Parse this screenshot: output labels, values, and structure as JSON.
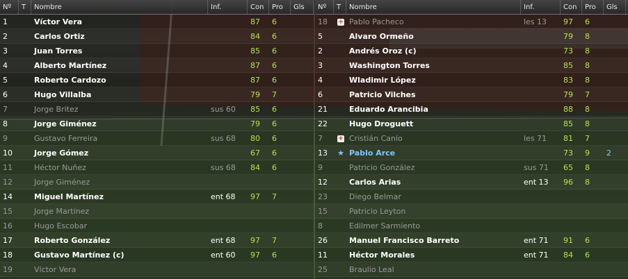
{
  "colors": {
    "con_pro": "#b8e24a",
    "goals": "#7fc6ff",
    "dimmed": "#9a9a9a",
    "highlight": "#7fc6ff",
    "injury": "#d21d1d"
  },
  "headers": {
    "num": "Nº",
    "t": "T",
    "name": "Nombre",
    "inf": "Inf.",
    "con": "Con",
    "pro": "Pro",
    "gls": "Gls"
  },
  "left_team": [
    {
      "num": "1",
      "name": "Víctor Vera",
      "inf": "",
      "con": "87",
      "pro": "6",
      "gls": "",
      "dim": false
    },
    {
      "num": "2",
      "name": "Carlos Ortiz",
      "inf": "",
      "con": "84",
      "pro": "6",
      "gls": "",
      "dim": false
    },
    {
      "num": "3",
      "name": "Juan Torres",
      "inf": "",
      "con": "85",
      "pro": "6",
      "gls": "",
      "dim": false
    },
    {
      "num": "4",
      "name": "Alberto Martínez",
      "inf": "",
      "con": "87",
      "pro": "6",
      "gls": "",
      "dim": false
    },
    {
      "num": "5",
      "name": "Roberto Cardozo",
      "inf": "",
      "con": "87",
      "pro": "6",
      "gls": "",
      "dim": false
    },
    {
      "num": "6",
      "name": "Hugo Villalba",
      "inf": "",
      "con": "79",
      "pro": "7",
      "gls": "",
      "dim": false
    },
    {
      "num": "7",
      "name": "Jorge Britez",
      "inf": "sus 60",
      "con": "85",
      "pro": "6",
      "gls": "",
      "dim": true
    },
    {
      "num": "8",
      "name": "Jorge Giménez",
      "inf": "",
      "con": "79",
      "pro": "6",
      "gls": "",
      "dim": false
    },
    {
      "num": "9",
      "name": "Gustavo Ferreira",
      "inf": "sus 68",
      "con": "80",
      "pro": "6",
      "gls": "",
      "dim": true
    },
    {
      "num": "10",
      "name": "Jorge Gómez",
      "inf": "",
      "con": "67",
      "pro": "6",
      "gls": "",
      "dim": false
    },
    {
      "num": "11",
      "name": "Héctor Nuñez",
      "inf": "sus 68",
      "con": "84",
      "pro": "6",
      "gls": "",
      "dim": true
    },
    {
      "num": "12",
      "name": "Jorge Giménez",
      "inf": "",
      "con": "",
      "pro": "",
      "gls": "",
      "dim": true
    },
    {
      "num": "14",
      "name": "Miguel Martínez",
      "inf": "ent 68",
      "con": "97",
      "pro": "7",
      "gls": "",
      "dim": false
    },
    {
      "num": "15",
      "name": "Jorge Martínez",
      "inf": "",
      "con": "",
      "pro": "",
      "gls": "",
      "dim": true
    },
    {
      "num": "16",
      "name": "Hugo Escobar",
      "inf": "",
      "con": "",
      "pro": "",
      "gls": "",
      "dim": true
    },
    {
      "num": "17",
      "name": "Roberto González",
      "inf": "ent 68",
      "con": "97",
      "pro": "7",
      "gls": "",
      "dim": false
    },
    {
      "num": "18",
      "name": "Gustavo Martínez (c)",
      "inf": "ent 60",
      "con": "97",
      "pro": "6",
      "gls": "",
      "dim": false
    },
    {
      "num": "19",
      "name": "Víctor Vera",
      "inf": "",
      "con": "",
      "pro": "",
      "gls": "",
      "dim": true
    }
  ],
  "right_team": [
    {
      "num": "18",
      "icon": "injury-icon",
      "name": "Pablo Pacheco",
      "inf": "les 13",
      "con": "97",
      "pro": "6",
      "gls": "",
      "dim": true,
      "hl": false
    },
    {
      "num": "5",
      "icon": "",
      "name": "Alvaro Ormeño",
      "inf": "",
      "con": "79",
      "pro": "8",
      "gls": "",
      "dim": false,
      "hl": false
    },
    {
      "num": "2",
      "icon": "",
      "name": "Andrés Oroz (c)",
      "inf": "",
      "con": "73",
      "pro": "8",
      "gls": "",
      "dim": false,
      "hl": false
    },
    {
      "num": "3",
      "icon": "",
      "name": "Washington Torres",
      "inf": "",
      "con": "85",
      "pro": "8",
      "gls": "",
      "dim": false,
      "hl": false
    },
    {
      "num": "4",
      "icon": "",
      "name": "Wladimir López",
      "inf": "",
      "con": "83",
      "pro": "8",
      "gls": "",
      "dim": false,
      "hl": false
    },
    {
      "num": "6",
      "icon": "",
      "name": "Patricio Vilches",
      "inf": "",
      "con": "79",
      "pro": "7",
      "gls": "",
      "dim": false,
      "hl": false
    },
    {
      "num": "21",
      "icon": "",
      "name": "Eduardo Arancibia",
      "inf": "",
      "con": "88",
      "pro": "8",
      "gls": "",
      "dim": false,
      "hl": false
    },
    {
      "num": "22",
      "icon": "",
      "name": "Hugo Droguett",
      "inf": "",
      "con": "85",
      "pro": "8",
      "gls": "",
      "dim": false,
      "hl": false
    },
    {
      "num": "7",
      "icon": "injury-icon",
      "name": "Cristián Canío",
      "inf": "les 71",
      "con": "81",
      "pro": "7",
      "gls": "",
      "dim": true,
      "hl": false
    },
    {
      "num": "13",
      "icon": "star-icon",
      "name": "Pablo Arce",
      "inf": "",
      "con": "73",
      "pro": "9",
      "gls": "2",
      "dim": false,
      "hl": true
    },
    {
      "num": "9",
      "icon": "",
      "name": "Patricio González",
      "inf": "sus 71",
      "con": "65",
      "pro": "8",
      "gls": "",
      "dim": true,
      "hl": false
    },
    {
      "num": "12",
      "icon": "",
      "name": "Carlos Arias",
      "inf": "ent 13",
      "con": "96",
      "pro": "8",
      "gls": "",
      "dim": false,
      "hl": false
    },
    {
      "num": "23",
      "icon": "",
      "name": "Diego Belmar",
      "inf": "",
      "con": "",
      "pro": "",
      "gls": "",
      "dim": true,
      "hl": false
    },
    {
      "num": "15",
      "icon": "",
      "name": "Patricio Leyton",
      "inf": "",
      "con": "",
      "pro": "",
      "gls": "",
      "dim": true,
      "hl": false
    },
    {
      "num": "8",
      "icon": "",
      "name": "Edilmer Sarmiento",
      "inf": "",
      "con": "",
      "pro": "",
      "gls": "",
      "dim": true,
      "hl": false
    },
    {
      "num": "26",
      "icon": "",
      "name": "Manuel Francisco Barreto",
      "inf": "ent 71",
      "con": "91",
      "pro": "6",
      "gls": "",
      "dim": false,
      "hl": false
    },
    {
      "num": "11",
      "icon": "",
      "name": "Héctor Morales",
      "inf": "ent 71",
      "con": "84",
      "pro": "6",
      "gls": "",
      "dim": false,
      "hl": false
    },
    {
      "num": "25",
      "icon": "",
      "name": "Braulio Leal",
      "inf": "",
      "con": "",
      "pro": "",
      "gls": "",
      "dim": true,
      "hl": false
    }
  ]
}
